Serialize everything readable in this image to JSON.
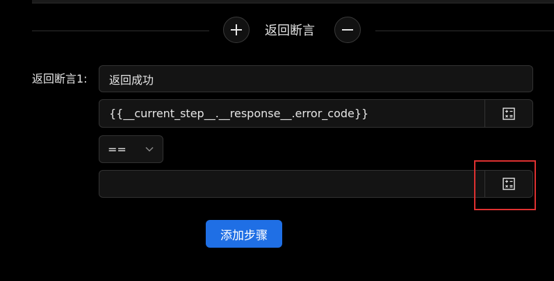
{
  "section": {
    "title": "返回断言",
    "add_icon": "plus-icon",
    "remove_icon": "minus-icon"
  },
  "assertion": {
    "label": "返回断言1:",
    "name_value": "返回成功",
    "expression_value": "{{__current_step__.__response__.error_code}}",
    "operator_value": "==",
    "expected_value": "",
    "variable_icon": "calculator-icon"
  },
  "actions": {
    "add_step_label": "添加步骤"
  },
  "colors": {
    "primary": "#1f6fe5",
    "highlight": "#e03131",
    "background": "#000000"
  }
}
